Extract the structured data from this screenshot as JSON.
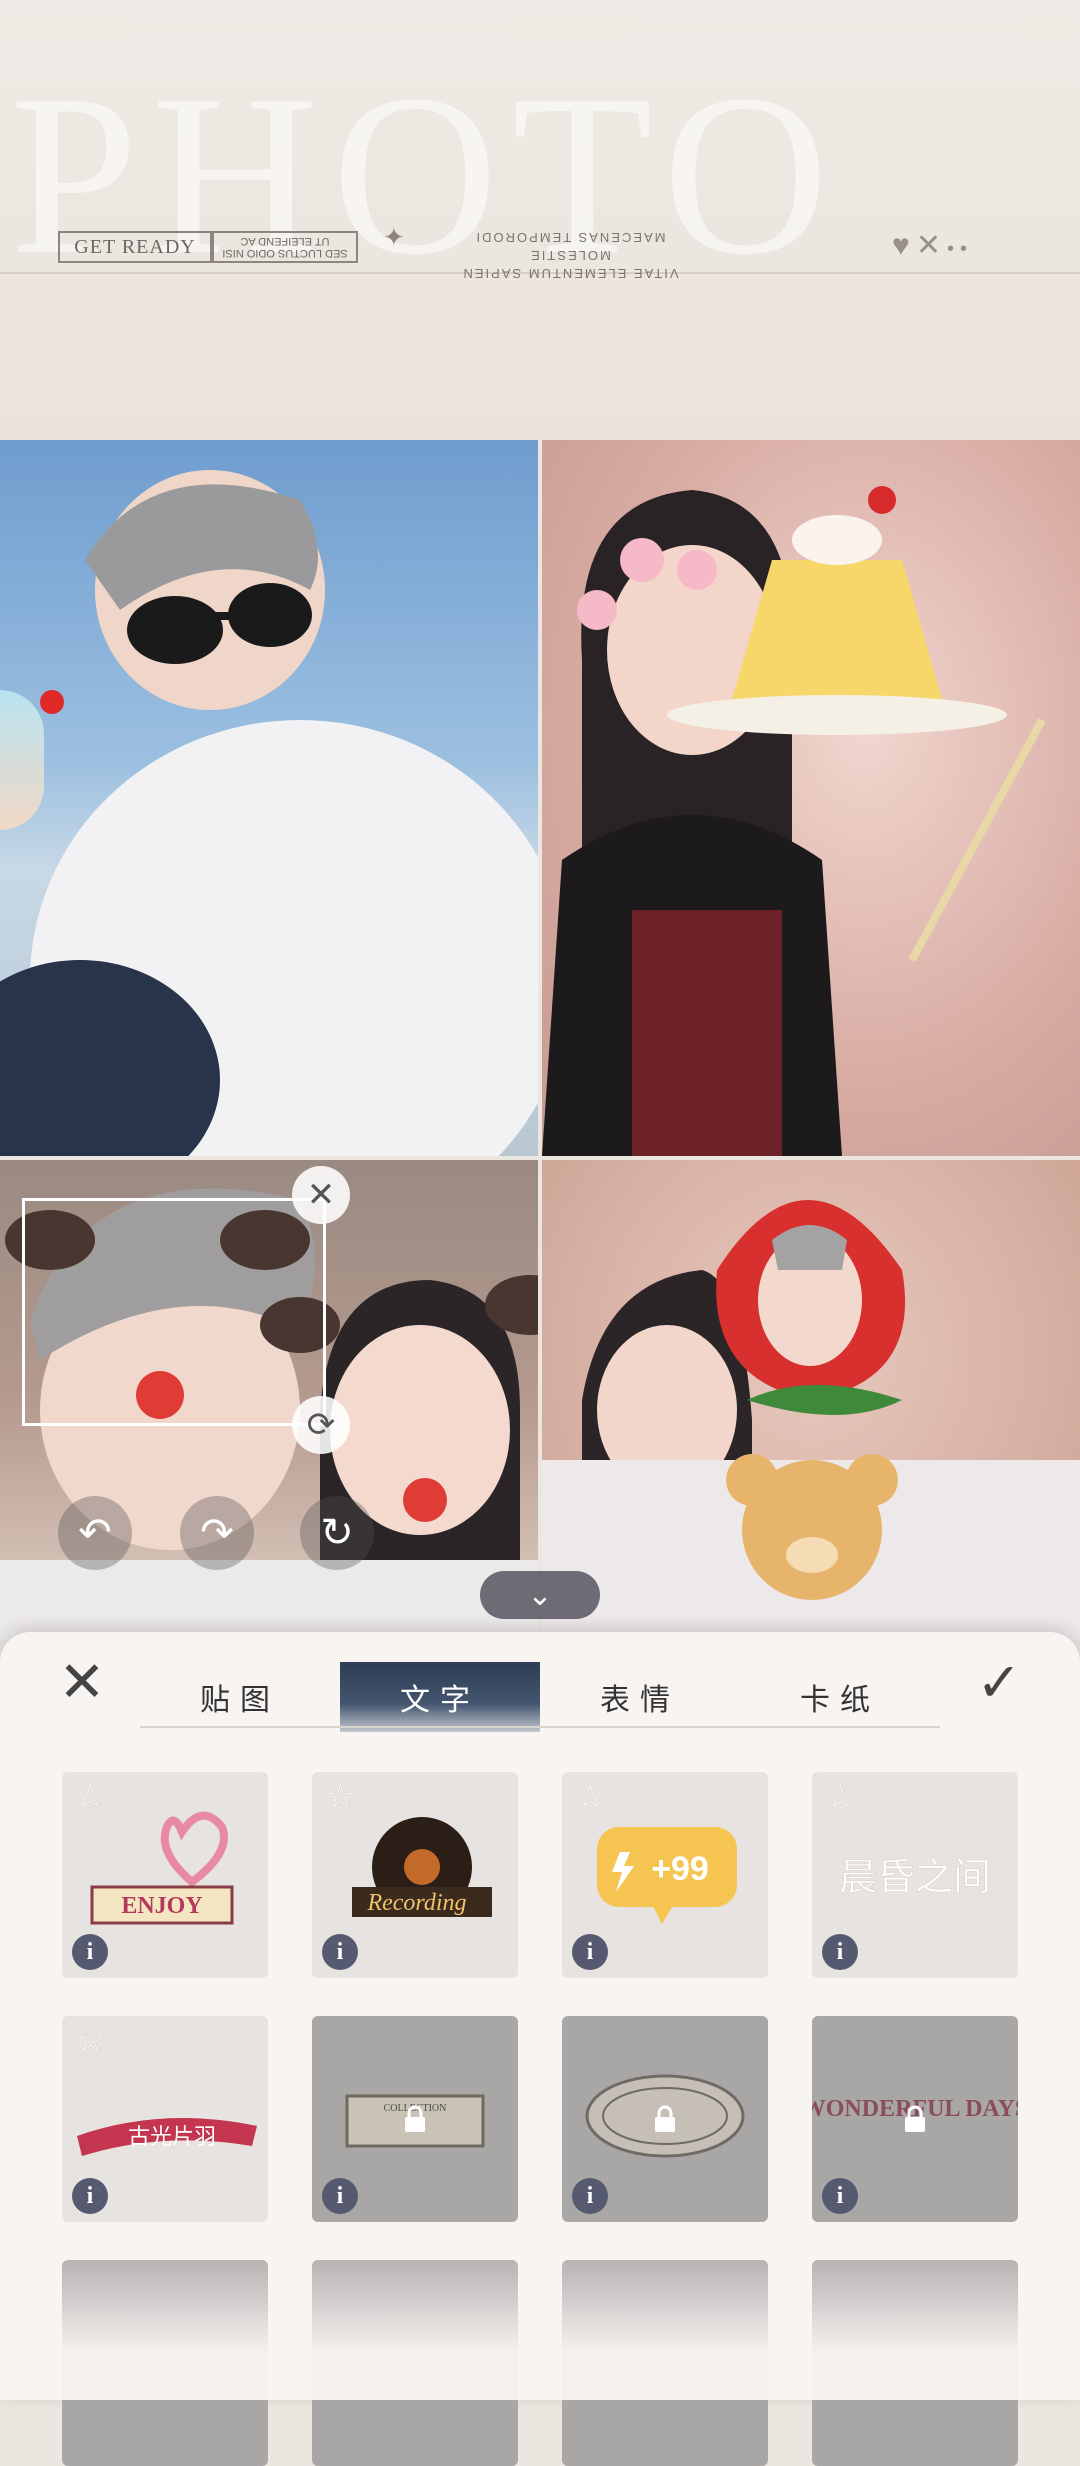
{
  "header": {
    "big_title": "PHOTO",
    "get_ready": "GET READY",
    "mini_code_line1": "SED LUCTUS ODIO NISI",
    "mini_code_line2": "UT ELEIFEND AC",
    "upside_line1": "VITAE ELEMENTUM SAPIEN MOLESTIE",
    "upside_line2": "MAECENAS TEMPORODI"
  },
  "editor": {
    "collapse_icon": "chevron-down-icon",
    "undo_icon": "undo-icon",
    "redo_icon": "redo-icon",
    "reset_icon": "refresh-icon"
  },
  "panel": {
    "close_icon": "close-icon",
    "confirm_icon": "check-icon",
    "tabs": [
      {
        "label": "贴图"
      },
      {
        "label": "文字"
      },
      {
        "label": "表情"
      },
      {
        "label": "卡纸"
      }
    ],
    "active_tab": 1,
    "stickers": [
      {
        "text": "ENJOY",
        "locked": false
      },
      {
        "text": "Recording",
        "locked": false
      },
      {
        "text": "+99",
        "locked": false
      },
      {
        "text": "晨昏之间",
        "locked": false
      },
      {
        "text": "古光片羽",
        "locked": false
      },
      {
        "text": "COLLECTION",
        "locked": true
      },
      {
        "text": "",
        "locked": true
      },
      {
        "text": "WONDERFUL DAYS",
        "locked": true
      }
    ]
  },
  "colors": {
    "accent_dark": "#2d3b54",
    "info_badge": "#565a70",
    "sticker_red": "#e02a2a"
  }
}
